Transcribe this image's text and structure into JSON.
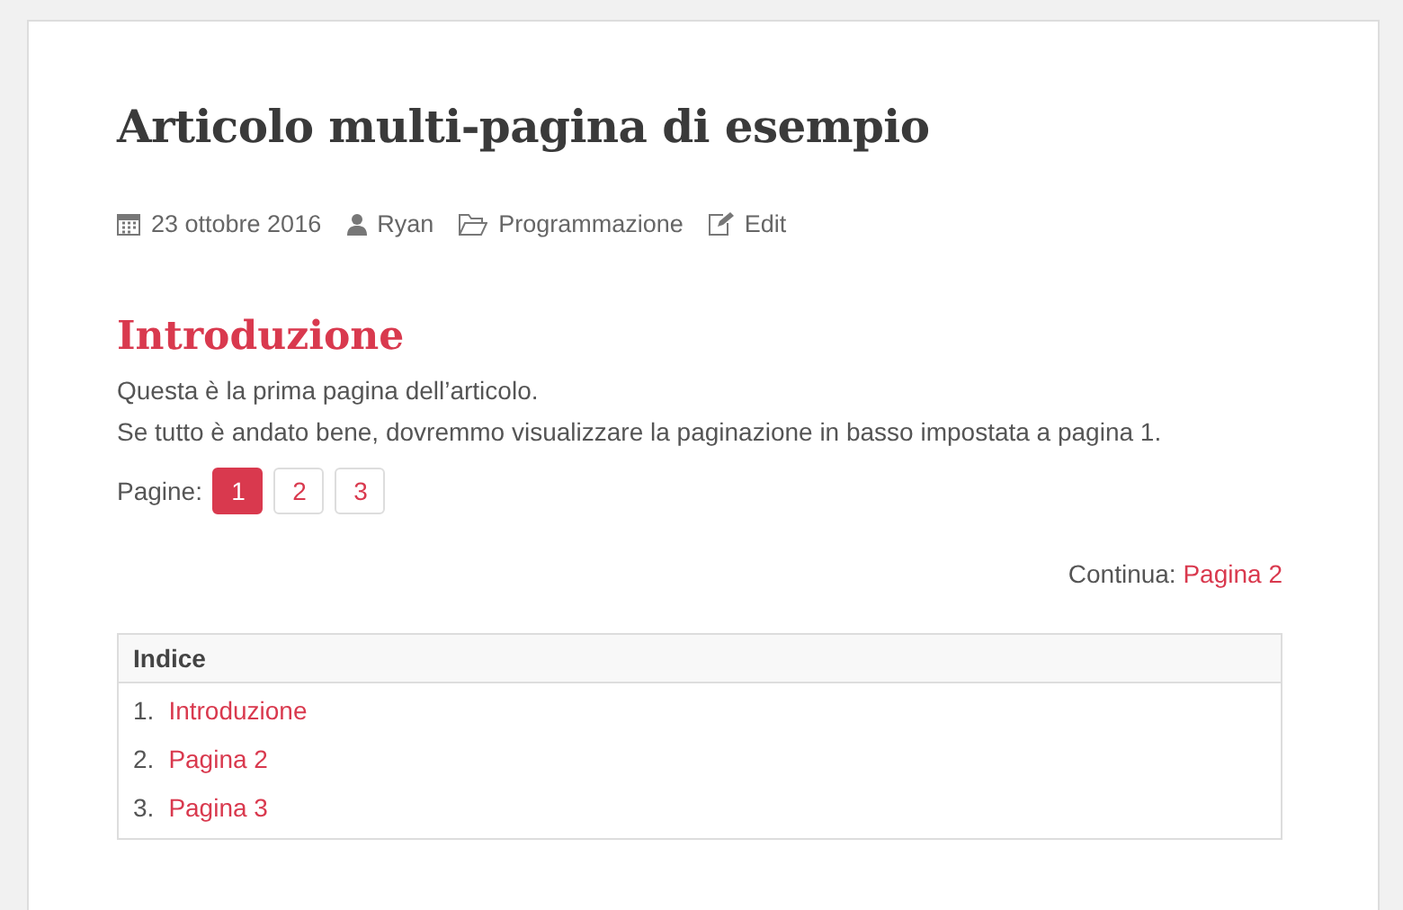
{
  "article": {
    "title": "Articolo multi-pagina di esempio",
    "meta": [
      {
        "kind": "date",
        "text": "23 ottobre 2016"
      },
      {
        "kind": "author",
        "text": "Ryan"
      },
      {
        "kind": "category",
        "text": "Programmazione"
      },
      {
        "kind": "edit",
        "text": "Edit"
      }
    ],
    "heading": "Introduzione",
    "paragraphs": [
      "Questa è la prima pagina dell’articolo.",
      "Se tutto è andato bene, dovremmo visualizzare la paginazione in basso impostata a pagina 1."
    ],
    "pagination": {
      "label": "Pagine:",
      "pages": [
        {
          "label": "1",
          "selected": true
        },
        {
          "label": "2",
          "selected": false
        },
        {
          "label": "3",
          "selected": false
        }
      ]
    },
    "continue": {
      "label": "Continua:",
      "link": "Pagina 2"
    },
    "toc": {
      "title": "Indice",
      "items": [
        {
          "number": "1.",
          "label": "Introduzione"
        },
        {
          "number": "2.",
          "label": "Pagina 2"
        },
        {
          "number": "3.",
          "label": "Pagina 3"
        }
      ]
    }
  }
}
